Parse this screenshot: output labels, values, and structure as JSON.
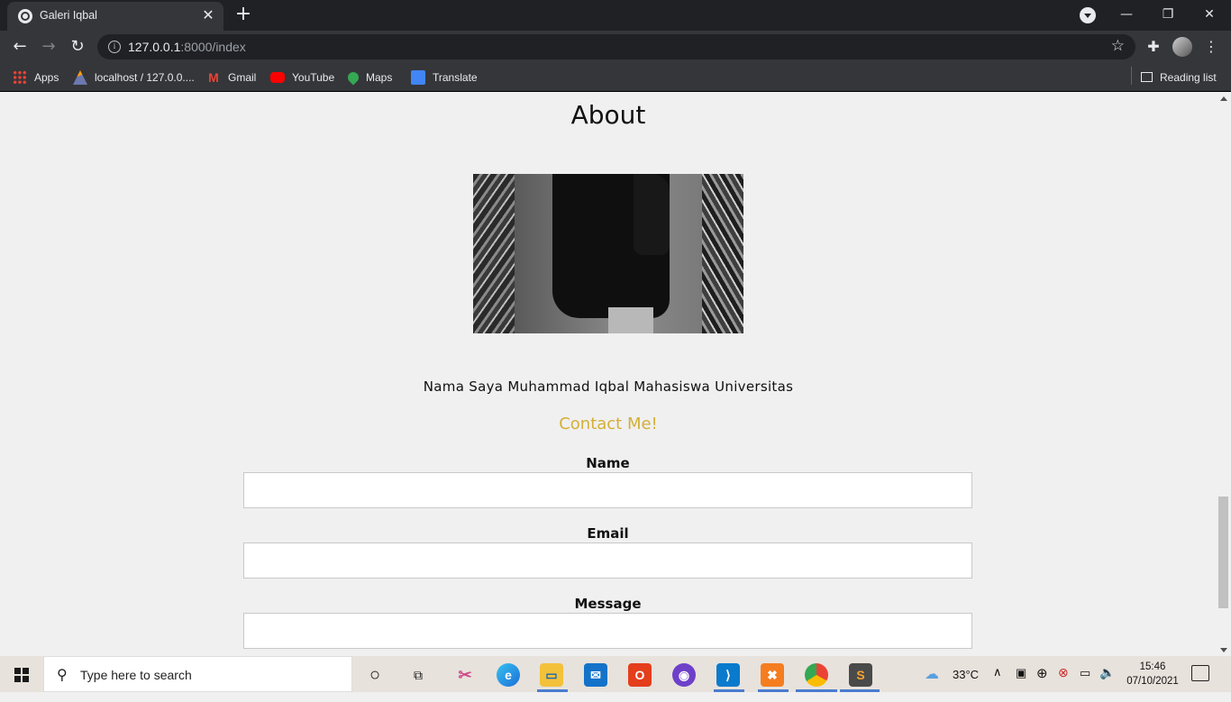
{
  "browser": {
    "tab_title": "Galeri Iqbal",
    "tab_close": "✕",
    "new_tab": "+",
    "url_host": "127.0.0.1",
    "url_rest": ":8000/index",
    "window_controls": {
      "minimize": "—",
      "restore": "❐",
      "close": "✕"
    },
    "bookmarks": [
      {
        "label": "Apps",
        "icon": "apps-grid-icon"
      },
      {
        "label": "localhost / 127.0.0....",
        "icon": "phpmyadmin-icon"
      },
      {
        "label": "Gmail",
        "icon": "gmail-icon"
      },
      {
        "label": "YouTube",
        "icon": "youtube-icon"
      },
      {
        "label": "Maps",
        "icon": "maps-icon"
      },
      {
        "label": "Translate",
        "icon": "translate-icon"
      }
    ],
    "reading_list": "Reading list"
  },
  "page": {
    "about_title": "About",
    "bio": "Nama Saya Muhammad Iqbal Mahasiswa Universitas",
    "contact_heading": "Contact Me!",
    "form": {
      "name_label": "Name",
      "name_value": "",
      "email_label": "Email",
      "email_value": "",
      "message_label": "Message",
      "message_value": ""
    }
  },
  "taskbar": {
    "search_placeholder": "Type here to search",
    "weather": "33°C",
    "time": "15:46",
    "date": "07/10/2021"
  },
  "colors": {
    "accent_contact": "#d4af37",
    "chrome_dark": "#202124",
    "chrome_mid": "#35363a"
  }
}
